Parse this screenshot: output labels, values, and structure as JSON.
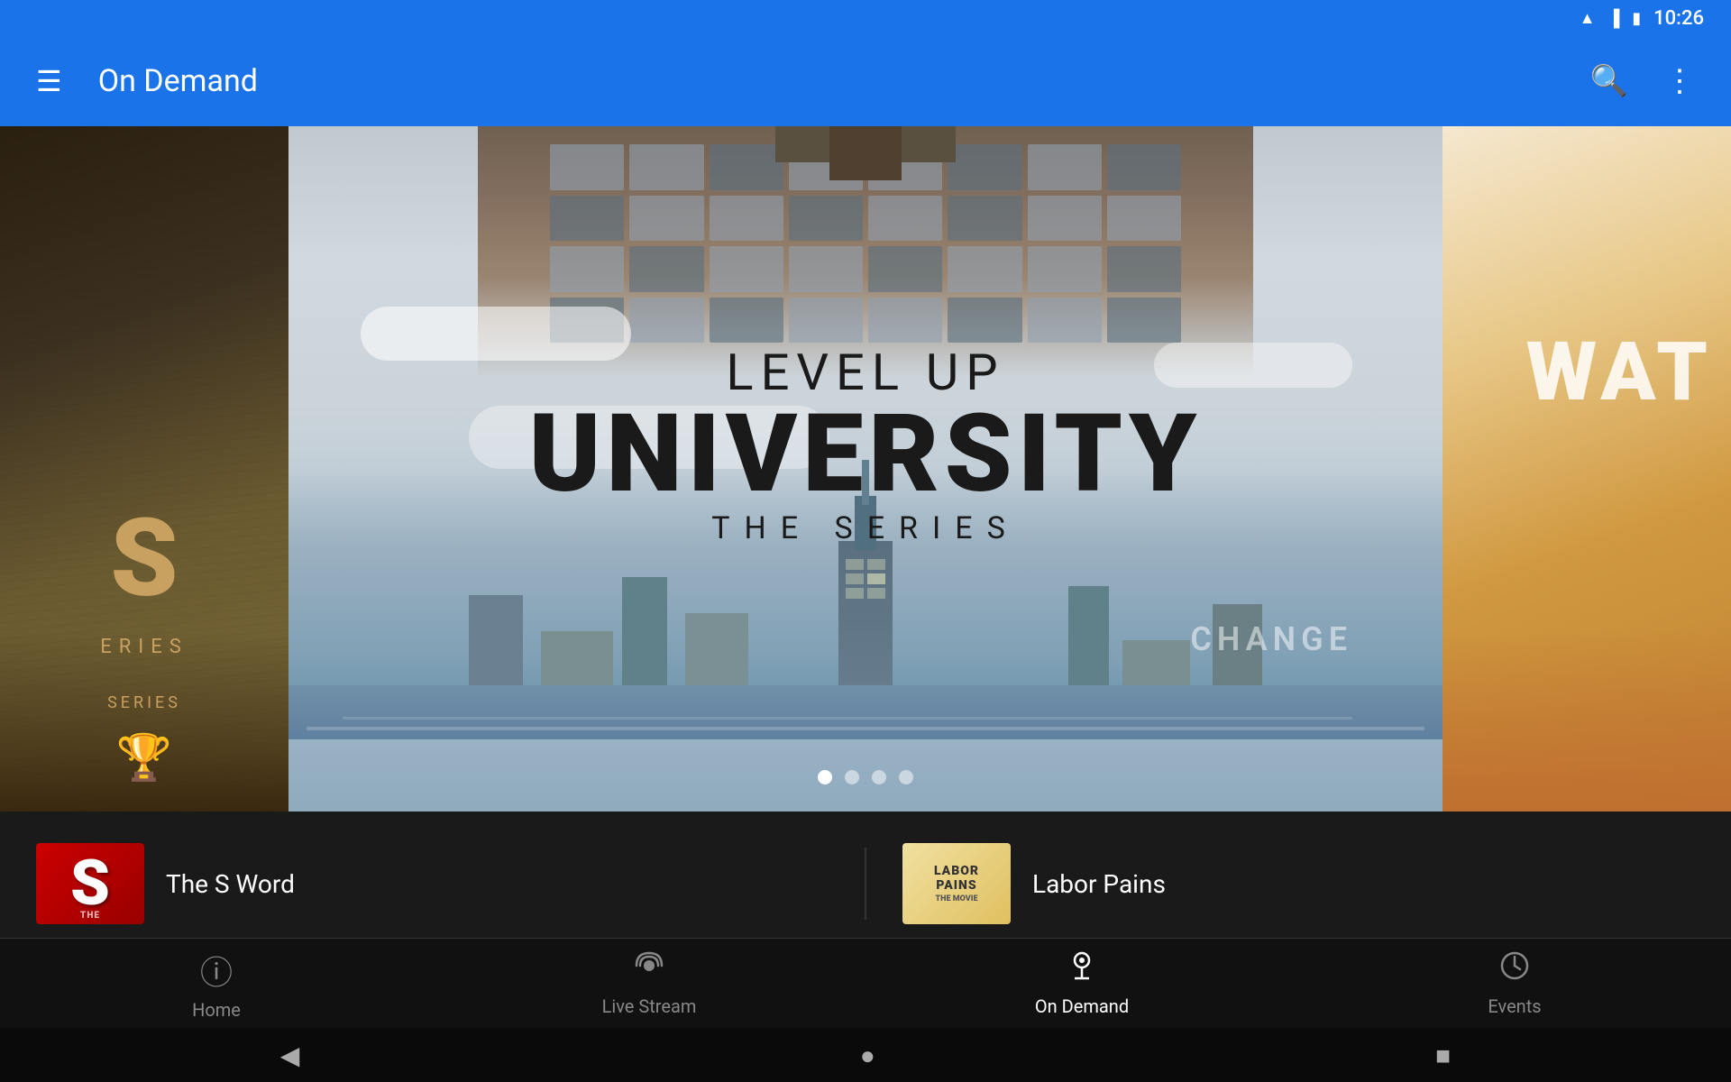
{
  "statusBar": {
    "time": "10:26",
    "wifiIcon": "wifi",
    "signalIcon": "signal",
    "batteryIcon": "battery"
  },
  "appBar": {
    "title": "On Demand",
    "menuIcon": "menu",
    "searchIcon": "search",
    "moreIcon": "more"
  },
  "hero": {
    "leftCard": {
      "text": "S",
      "subtext": "ERIES",
      "label": "SERIES"
    },
    "centerCard": {
      "levelup": "LEVEL UP",
      "university": "UNIVERSITY",
      "series": "THE SERIES",
      "watermark": "CHANGE"
    },
    "rightCard": {
      "text": "WAT"
    },
    "dots": [
      {
        "active": true
      },
      {
        "active": false
      },
      {
        "active": false
      },
      {
        "active": false
      }
    ]
  },
  "contentRow": {
    "items": [
      {
        "thumbLabel": "S",
        "title": "The S Word"
      },
      {
        "thumbLabel": "LABOR PAINS",
        "title": "Labor Pains"
      }
    ]
  },
  "bottomNav": {
    "items": [
      {
        "label": "Home",
        "icon": "⊙",
        "active": false
      },
      {
        "label": "Live Stream",
        "icon": "📡",
        "active": false
      },
      {
        "label": "On Demand",
        "icon": "🎧",
        "active": true
      },
      {
        "label": "Events",
        "icon": "⏱",
        "active": false
      }
    ]
  },
  "androidNav": {
    "backIcon": "◀",
    "homeIcon": "●",
    "recentIcon": "■"
  }
}
